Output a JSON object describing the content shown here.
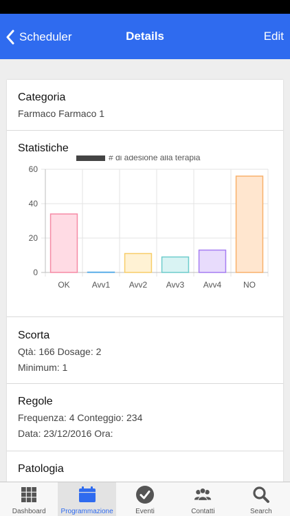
{
  "nav": {
    "back_label": "Scheduler",
    "title": "Details",
    "edit_label": "Edit"
  },
  "categoria": {
    "title": "Categoria",
    "value": "Farmaco Farmaco 1"
  },
  "statistiche": {
    "title": "Statistiche"
  },
  "chart_data": {
    "type": "bar",
    "categories": [
      "OK",
      "Avv1",
      "Avv2",
      "Avv3",
      "Avv4",
      "NO"
    ],
    "series": [
      {
        "name": "# di adesione alla terapia",
        "values": [
          34,
          0,
          11,
          9,
          13,
          56
        ]
      }
    ],
    "bar_fills": [
      "#ffdbe4",
      "#d6ebfa",
      "#fff2d4",
      "#d9f3f3",
      "#e8dcfc",
      "#ffe6cf"
    ],
    "bar_strokes": [
      "#f58aa5",
      "#5aaee8",
      "#f7cd68",
      "#6dcccc",
      "#a67df2",
      "#f8b06b"
    ],
    "legend_color": "#444444",
    "legend_position": "top",
    "ylim": [
      0,
      60
    ],
    "yticks": [
      "0",
      "20",
      "40",
      "60"
    ],
    "grid": true
  },
  "scorta": {
    "title": "Scorta",
    "line1": "Qtà: 166 Dosage: 2",
    "line2": "Minimum: 1"
  },
  "regole": {
    "title": "Regole",
    "line1": "Frequenza: 4 Conteggio: 234",
    "line2": "Data: 23/12/2016 Ora:"
  },
  "patologia": {
    "title": "Patologia"
  },
  "tabs": [
    {
      "label": "Dashboard",
      "icon": "grid-icon",
      "active": false
    },
    {
      "label": "Programmazione",
      "icon": "calendar-icon",
      "active": true
    },
    {
      "label": "Eventi",
      "icon": "check-circle-icon",
      "active": false
    },
    {
      "label": "Contatti",
      "icon": "people-icon",
      "active": false
    },
    {
      "label": "Search",
      "icon": "search-icon",
      "active": false
    }
  ],
  "colors": {
    "accent": "#2f6bef",
    "status_bar": "#000000"
  }
}
